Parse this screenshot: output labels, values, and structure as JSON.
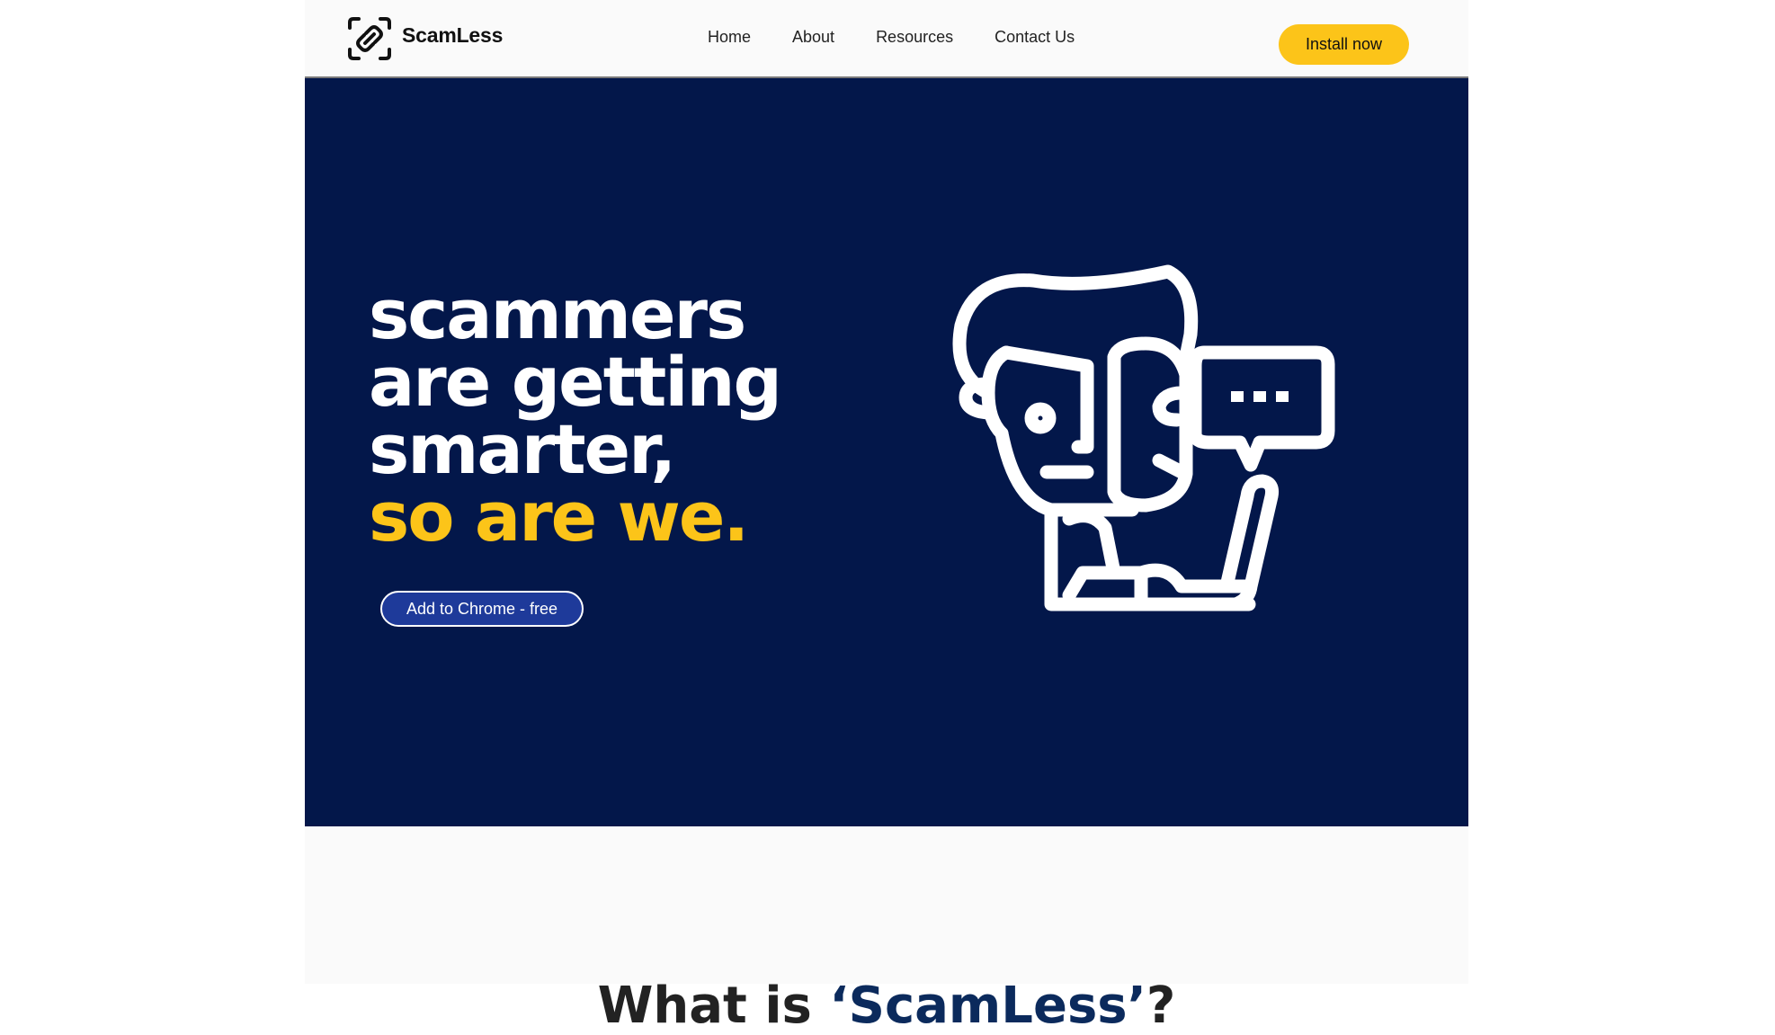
{
  "header": {
    "brand": "ScamLess",
    "nav": [
      "Home",
      "About",
      "Resources",
      "Contact Us"
    ],
    "install_label": "Install now"
  },
  "hero": {
    "headline_lines": [
      "scammers",
      "are getting",
      "smarter,"
    ],
    "headline_accent": "so are we.",
    "cta_label": "Add to Chrome - free",
    "illustration_icon": "person-laptop-chat-icon"
  },
  "what_is": {
    "prefix": "What is ",
    "brand_quoted": "‘ScamLess’",
    "suffix": "?"
  },
  "colors": {
    "hero_bg": "#03174a",
    "accent_yellow": "#fcc419",
    "cta_blue": "#1e3a9a"
  }
}
